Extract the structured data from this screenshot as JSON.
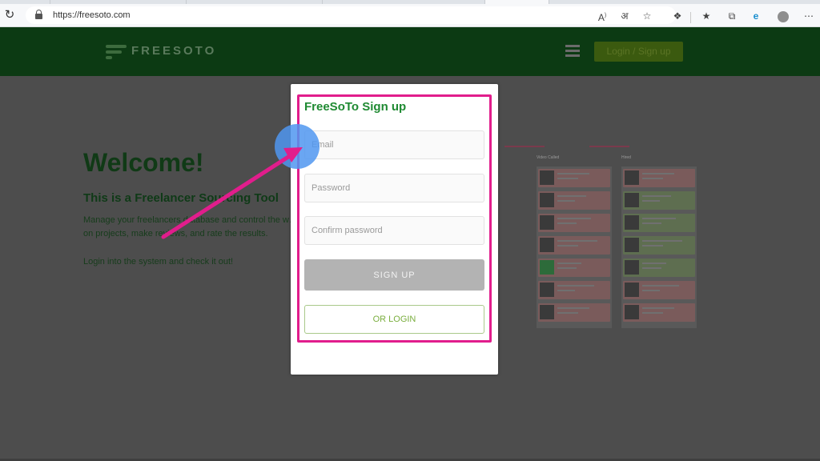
{
  "browser": {
    "url": "https://freesoto.com",
    "icons": {
      "reload": "reload-icon",
      "lock": "lock-icon",
      "read_aloud": "read-aloud-icon",
      "translate": "translate-icon",
      "favorite": "star-icon",
      "extensions": "extensions-icon",
      "favorites": "favorites-icon",
      "collections": "collections-icon",
      "edge": "edge-icon",
      "profile": "profile-icon",
      "more": "more-icon"
    }
  },
  "site": {
    "logo_text": "FREESOTO",
    "login_button": "Login / Sign up"
  },
  "hero": {
    "title": "Welcome!",
    "subtitle": "This is a Freelancer Sourcing Tool",
    "description": "Manage your freelancers database and control the w… on projects, make reviews, and rate the results.",
    "cta": "Login into the system and check it out!"
  },
  "board": {
    "columns": [
      "Video Called",
      "Hired"
    ]
  },
  "modal": {
    "title": "FreeSoTo Sign up",
    "email_placeholder": "Email",
    "password_placeholder": "Password",
    "confirm_placeholder": "Confirm password",
    "signup_label": "SIGN UP",
    "or_login_label": "OR LOGIN"
  },
  "colors": {
    "brand_green": "#1f8a32",
    "highlight": "#e11d8c",
    "card_red": "#f4b6b6",
    "card_green": "#c6e6b0",
    "card_yellow": "#f5dd9e"
  }
}
